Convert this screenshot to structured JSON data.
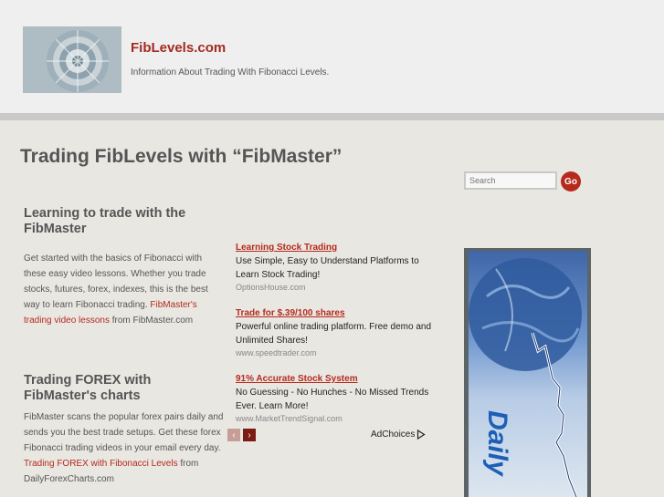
{
  "site": {
    "title": "FibLevels.com",
    "tagline": "Information About Trading With Fibonacci Levels."
  },
  "page": {
    "title": "Trading FibLevels with “FibMaster”"
  },
  "search": {
    "placeholder": "Search",
    "go_label": "Go"
  },
  "sections": [
    {
      "title": "Learning to trade with the FibMaster",
      "body_text": "Get started with the basics of Fibonacci with these easy video lessons. Whether you trade stocks, futures, forex, indexes, this is the best way to learn Fibonacci trading. ",
      "link_text": "FibMaster's trading video lessons",
      "suffix": " from FibMaster.com"
    },
    {
      "title": "Trading FOREX with FibMaster's charts",
      "body_text": "FibMaster scans the popular forex pairs daily and sends you the best trade setups. Get these forex Fibonacci trading videos in your email every day. ",
      "link_text": "Trading FOREX with Fibonacci Levels",
      "suffix": " from DailyForexCharts.com"
    }
  ],
  "ads": [
    {
      "title": "Learning Stock Trading",
      "description": "Use Simple, Easy to Understand Platforms to Learn Stock Trading!",
      "url": "OptionsHouse.com"
    },
    {
      "title": "Trade for $.39/100 shares",
      "description": "Powerful online trading platform. Free demo and Unlimited Shares!",
      "url": "www.speedtrader.com"
    },
    {
      "title": "91% Accurate Stock System",
      "description": "No Guessing - No Hunches - No Missed Trends Ever. Learn More!",
      "url": "www.MarketTrendSignal.com"
    }
  ],
  "ad_controls": {
    "prev": "‹",
    "next": "›",
    "adchoices": "AdChoices"
  },
  "banner": {
    "word": "Daily"
  },
  "colors": {
    "accent": "#b52a1d",
    "header_bg": "#efefef",
    "page_bg": "#e9e7e2"
  }
}
